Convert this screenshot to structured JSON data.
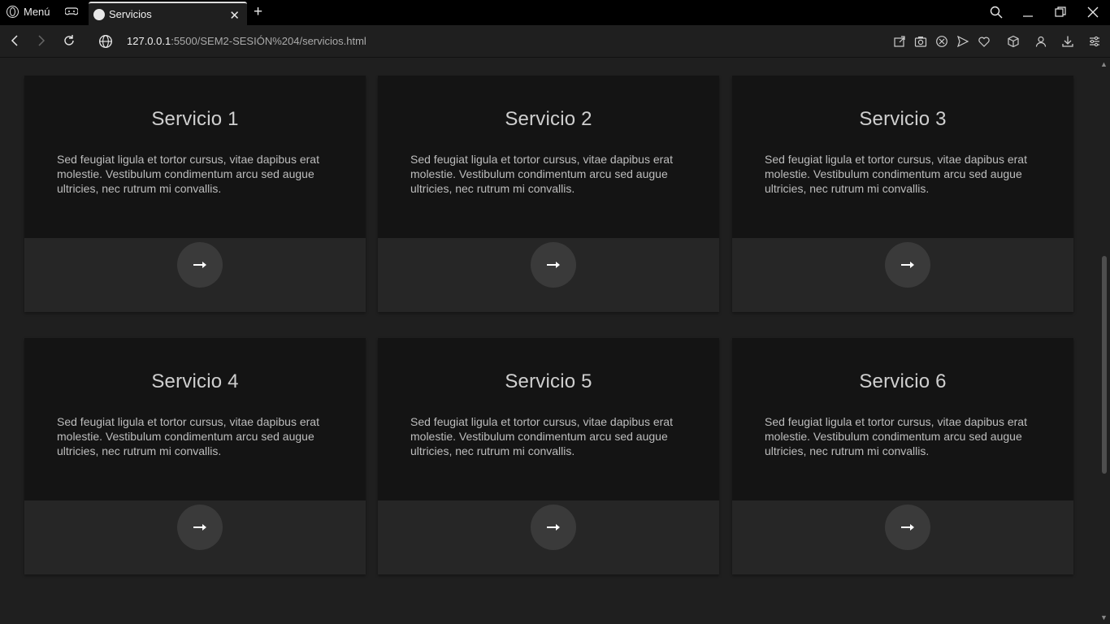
{
  "browser": {
    "menu_label": "Menú",
    "tab_title": "Servicios",
    "url_host": "127.0.0.1",
    "url_path": ":5500/SEM2-SESIÓN%204/servicios.html"
  },
  "cards": [
    {
      "title": "Servicio 1",
      "text": "Sed feugiat ligula et tortor cursus, vitae dapibus erat molestie. Vestibulum condimentum arcu sed augue ultricies, nec rutrum mi convallis."
    },
    {
      "title": "Servicio 2",
      "text": "Sed feugiat ligula et tortor cursus, vitae dapibus erat molestie. Vestibulum condimentum arcu sed augue ultricies, nec rutrum mi convallis."
    },
    {
      "title": "Servicio 3",
      "text": "Sed feugiat ligula et tortor cursus, vitae dapibus erat molestie. Vestibulum condimentum arcu sed augue ultricies, nec rutrum mi convallis."
    },
    {
      "title": "Servicio 4",
      "text": "Sed feugiat ligula et tortor cursus, vitae dapibus erat molestie. Vestibulum condimentum arcu sed augue ultricies, nec rutrum mi convallis."
    },
    {
      "title": "Servicio 5",
      "text": "Sed feugiat ligula et tortor cursus, vitae dapibus erat molestie. Vestibulum condimentum arcu sed augue ultricies, nec rutrum mi convallis."
    },
    {
      "title": "Servicio 6",
      "text": "Sed feugiat ligula et tortor cursus, vitae dapibus erat molestie. Vestibulum condimentum arcu sed augue ultricies, nec rutrum mi convallis."
    }
  ],
  "icons": {
    "card_button": "arrow-right-icon"
  },
  "colors": {
    "page_bg": "#1f1f1f",
    "card_top": "#141414",
    "card_bottom": "#262626",
    "button_bg": "#3a3a3a"
  }
}
